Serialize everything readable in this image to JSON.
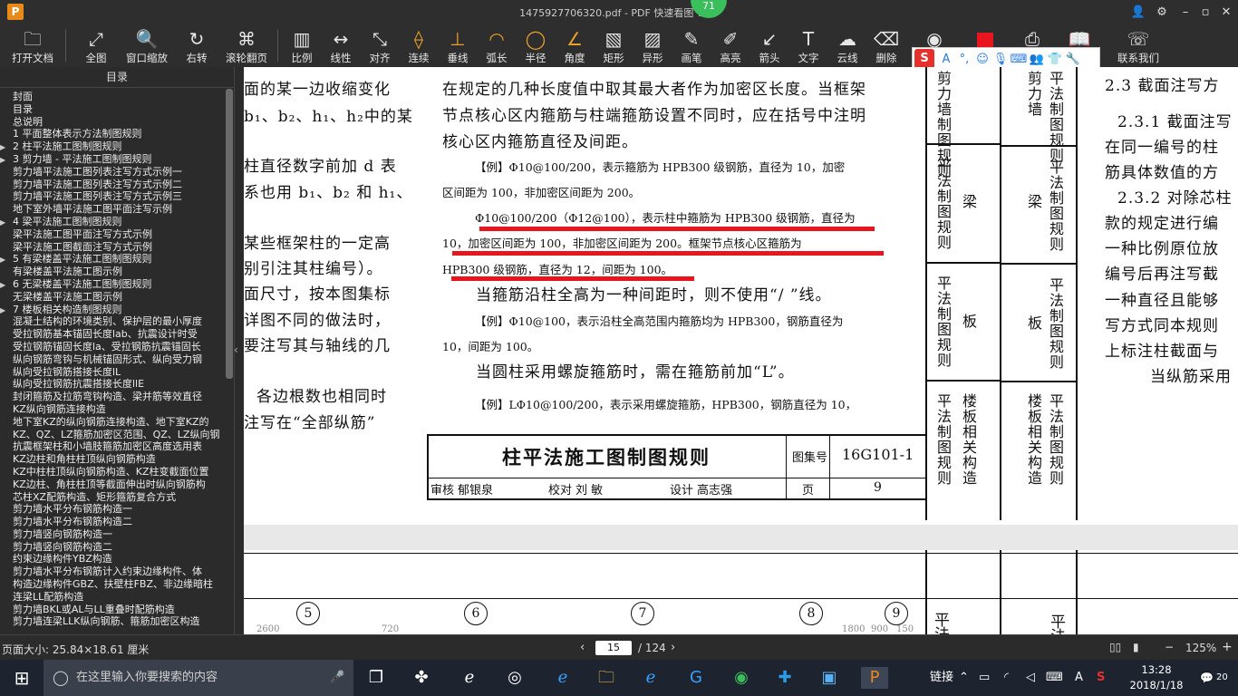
{
  "window": {
    "title": "1475927706320.pdf - PDF 快速看图 v1.9",
    "badge": "71",
    "app_logo": "P"
  },
  "toolbar": {
    "items": [
      {
        "label": "打开文档",
        "icon": "folder-icon"
      },
      {
        "label": "全图",
        "icon": "fit-icon"
      },
      {
        "label": "窗口缩放",
        "icon": "zoom-icon"
      },
      {
        "label": "右转",
        "icon": "rotate-right-icon"
      },
      {
        "label": "滚轮翻页",
        "icon": "mouse-wheel-icon"
      },
      {
        "label": "比例",
        "icon": "ruler-icon"
      },
      {
        "label": "线性",
        "icon": "linear-measure-icon"
      },
      {
        "label": "对齐",
        "icon": "aligned-measure-icon"
      },
      {
        "label": "连续",
        "icon": "continuous-measure-icon"
      },
      {
        "label": "垂线",
        "icon": "perpendicular-icon"
      },
      {
        "label": "弧长",
        "icon": "arc-length-icon"
      },
      {
        "label": "半径",
        "icon": "radius-icon"
      },
      {
        "label": "角度",
        "icon": "angle-icon"
      },
      {
        "label": "矩形",
        "icon": "rectangle-icon"
      },
      {
        "label": "异形",
        "icon": "irregular-shape-icon"
      },
      {
        "label": "画笔",
        "icon": "pen-icon"
      },
      {
        "label": "高亮",
        "icon": "highlighter-icon"
      },
      {
        "label": "箭头",
        "icon": "arrow-icon"
      },
      {
        "label": "文字",
        "icon": "text-icon"
      },
      {
        "label": "云线",
        "icon": "cloud-line-icon"
      },
      {
        "label": "删除",
        "icon": "eraser-icon"
      },
      {
        "label": "联系我们",
        "icon": "contact-icon"
      }
    ],
    "color_swatch": "#e8141e"
  },
  "sidebar": {
    "title": "目录",
    "items": [
      {
        "label": "封面",
        "arrow": ""
      },
      {
        "label": "目录",
        "arrow": ""
      },
      {
        "label": "总说明",
        "arrow": ""
      },
      {
        "label": "1 平面整体表示方法制图规则",
        "arrow": ""
      },
      {
        "label": "2 柱平法施工图制图规则",
        "arrow": "▶"
      },
      {
        "label": "3 剪力墙 - 平法施工图制图规则",
        "arrow": "▶"
      },
      {
        "label": "剪力墙平法施工图列表注写方式示例一",
        "arrow": ""
      },
      {
        "label": "剪力墙平法施工图列表注写方式示例二",
        "arrow": ""
      },
      {
        "label": "剪力墙平法施工图列表注写方式示例三",
        "arrow": ""
      },
      {
        "label": "地下室外墙平法施工图平面注写示例",
        "arrow": ""
      },
      {
        "label": "4 梁平法施工图制图规则",
        "arrow": "▶"
      },
      {
        "label": "梁平法施工图平面注写方式示例",
        "arrow": ""
      },
      {
        "label": "梁平法施工图截面注写方式示例",
        "arrow": ""
      },
      {
        "label": "5 有梁楼盖平法施工图制图规则",
        "arrow": "▶"
      },
      {
        "label": "有梁楼盖平法施工图示例",
        "arrow": ""
      },
      {
        "label": "6 无梁楼盖平法施工图制图规则",
        "arrow": "▶"
      },
      {
        "label": "无梁楼盖平法施工图示例",
        "arrow": ""
      },
      {
        "label": "7 楼板相关构造制图规则",
        "arrow": "▶"
      },
      {
        "label": "混凝土结构的环境类别、保护层的最小厚度",
        "arrow": ""
      },
      {
        "label": "受拉钢筋基本锚固长度lab、抗震设计时受",
        "arrow": ""
      },
      {
        "label": "受拉钢筋锚固长度la、受拉钢筋抗震锚固长",
        "arrow": ""
      },
      {
        "label": "纵向钢筋弯钩与机械锚固形式、纵向受力钢",
        "arrow": ""
      },
      {
        "label": "纵向受拉钢筋搭接长度lL",
        "arrow": ""
      },
      {
        "label": "纵向受拉钢筋抗震搭接长度llE",
        "arrow": ""
      },
      {
        "label": "封闭箍筋及拉筋弯钩构造、梁并筋等效直径",
        "arrow": ""
      },
      {
        "label": "KZ纵向钢筋连接构造",
        "arrow": ""
      },
      {
        "label": "地下室KZ的纵向钢筋连接构造、地下室KZ的",
        "arrow": ""
      },
      {
        "label": "KZ、QZ、LZ箍筋加密区范围、QZ、LZ纵向钢",
        "arrow": ""
      },
      {
        "label": "抗震框架柱和小墙肢箍筋加密区高度选用表",
        "arrow": ""
      },
      {
        "label": "KZ边柱和角柱柱顶纵向钢筋构造",
        "arrow": ""
      },
      {
        "label": "KZ中柱柱顶纵向钢筋构造、KZ柱变截面位置",
        "arrow": ""
      },
      {
        "label": "KZ边柱、角柱柱顶等截面伸出时纵向钢筋构",
        "arrow": ""
      },
      {
        "label": "芯柱XZ配筋构造、矩形箍筋复合方式",
        "arrow": ""
      },
      {
        "label": "剪力墙水平分布钢筋构造一",
        "arrow": ""
      },
      {
        "label": "剪力墙水平分布钢筋构造二",
        "arrow": ""
      },
      {
        "label": "剪力墙竖向钢筋构造一",
        "arrow": ""
      },
      {
        "label": "剪力墙竖向钢筋构造二",
        "arrow": ""
      },
      {
        "label": "约束边缘构件YBZ构造",
        "arrow": ""
      },
      {
        "label": "剪力墙水平分布钢筋计入约束边缘构件、体",
        "arrow": ""
      },
      {
        "label": "构造边缘构件GBZ、扶壁柱FBZ、非边缘暗柱",
        "arrow": ""
      },
      {
        "label": "连梁LL配筋构造",
        "arrow": ""
      },
      {
        "label": "剪力墙BKL或AL与LL重叠时配筋构造",
        "arrow": ""
      },
      {
        "label": "剪力墙连梁LLK纵向钢筋、箍筋加密区构造",
        "arrow": ""
      }
    ]
  },
  "document": {
    "left_col": [
      "面的某一边收缩变化",
      "b₁、b₂、h₁、h₂中的某",
      "柱直径数字前加 d 表",
      "系也用 b₁、b₂ 和 h₁、",
      "某些框架柱的一定高",
      "别引注其柱编号）。",
      "面尺寸，按本图集标",
      "详图不同的做法时，",
      "要注写其与轴线的几",
      "各边根数也相同时",
      "注写在“全部纵筋”"
    ],
    "center_lines": [
      "在规定的几种长度值中取其最大者作为加密区长度。当框架",
      "节点核心区内箍筋与柱端箍筋设置不同时，应在括号中注明",
      "核心区内箍筋直径及间距。",
      "【例】Φ10@100/200，表示箍筋为 HPB300 级钢筋，直径为 10，加密",
      "区间距为 100，非加密区间距为 200。",
      "Φ10@100/200（Φ12@100），表示柱中箍筋为 HPB300 级钢筋，直径为",
      "10，加密区间距为 100，非加密区间距为 200。框架节点核心区箍筋为",
      "HPB300 级钢筋，直径为 12，间距为 100。",
      "当箍筋沿柱全高为一种间距时，则不使用“/ ”线。",
      "【例】Φ10@100，表示沿柱全高范围内箍筋均为 HPB300，钢筋直径为",
      "10，间距为 100。",
      "当圆柱采用螺旋箍筋时，需在箍筋前加“L”。",
      "【例】LΦ10@100/200，表示采用螺旋箍筋，HPB300，钢筋直径为 10，"
    ],
    "title_block": {
      "title": "柱平法施工图制图规则",
      "atlas_label": "图集号",
      "atlas_no": "16G101-1",
      "review": "审核",
      "reviewer": "郁银泉",
      "check": "校对",
      "checker": "刘  敏",
      "design": "设计",
      "designer": "高志强",
      "page_label": "页",
      "page_no": "9"
    },
    "tabs_a": [
      "剪力墙制图规则",
      "平法制图规则",
      "梁",
      "平法制图规则",
      "板",
      "平法制图规则",
      "楼板相关构造"
    ],
    "tabs_b": [
      "剪力墙",
      "平法制图规则",
      "梁",
      "平法制图规则",
      "板",
      "平法制图规则",
      "楼板相关构造",
      "平法制图规则"
    ],
    "right_col": [
      "2.3  截面注写方",
      "2.3.1  截面注写",
      "在同一编号的柱",
      "筋具体数值的方",
      "2.3.2  对除芯柱",
      "款的规定进行编",
      "一种比例原位放",
      "编号后再注写截",
      "一种直径且能够",
      "写方式同本规则",
      "上标注柱截面与",
      "当纵筋采用"
    ],
    "axis_labels": [
      "5",
      "6",
      "7",
      "8",
      "9"
    ],
    "bottom_dims": [
      "2600",
      "720",
      "1800",
      "900",
      "150"
    ],
    "bottom_tabs": [
      "平",
      "法",
      "平",
      "法"
    ]
  },
  "status": {
    "page_size": "页面大小: 25.84×18.61 厘米",
    "current_page": "15",
    "total_pages": "/ 124",
    "zoom": "125%",
    "zoom_minus": "−",
    "zoom_plus": "+"
  },
  "taskbar": {
    "search_placeholder": "在这里输入你要搜索的内容",
    "tray_label": "链接",
    "time": "13:28",
    "date": "2018/1/18",
    "notifications": "20",
    "ime": "A"
  }
}
